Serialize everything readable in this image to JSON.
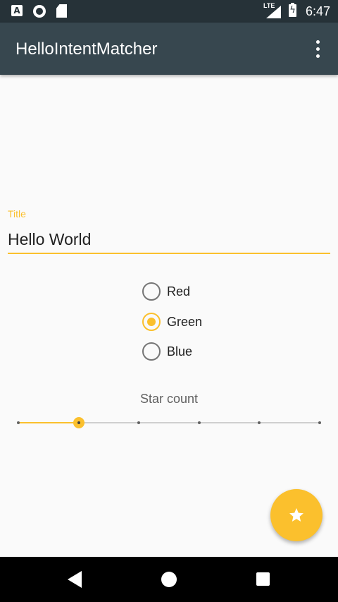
{
  "status_bar": {
    "time": "6:47",
    "network_label": "LTE",
    "notification_icons": [
      "font-notification-icon",
      "record-notification-icon",
      "sd-card-icon"
    ],
    "signal_icon": "cell-signal-icon",
    "battery_icon": "battery-charging-icon"
  },
  "app_bar": {
    "title": "HelloIntentMatcher",
    "overflow_icon": "more-vert-icon"
  },
  "title_field": {
    "label": "Title",
    "value": "Hello World"
  },
  "color_options": [
    {
      "label": "Red",
      "checked": false
    },
    {
      "label": "Green",
      "checked": true
    },
    {
      "label": "Blue",
      "checked": false
    }
  ],
  "star_count": {
    "label": "Star count",
    "min": 0,
    "max": 5,
    "value": 1
  },
  "fab": {
    "icon": "star-icon"
  },
  "colors": {
    "accent": "#fbc02d",
    "primary": "#37474f",
    "primary_dark": "#263238"
  }
}
